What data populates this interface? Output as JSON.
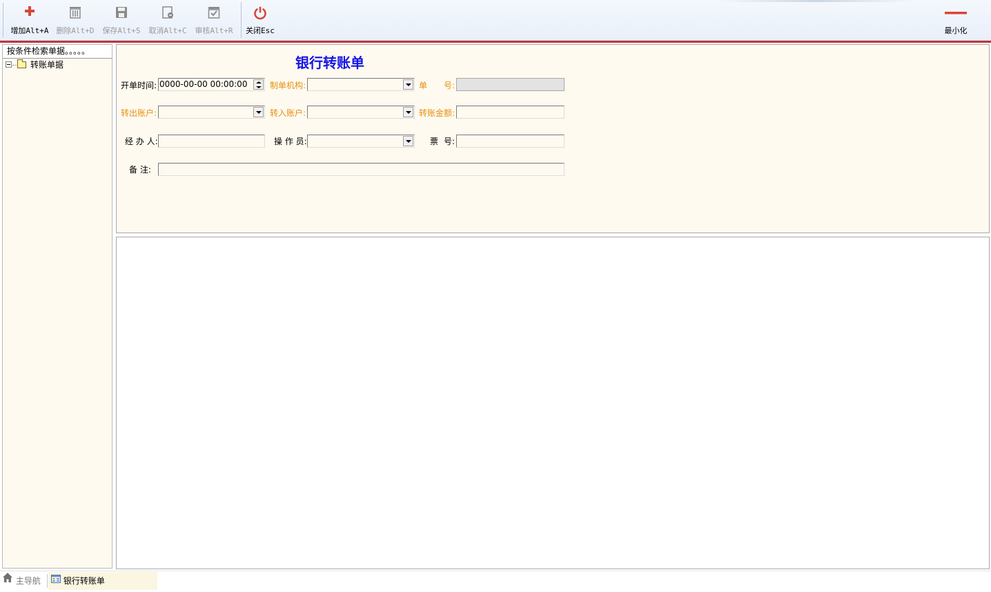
{
  "toolbar": {
    "buttons": [
      {
        "label": "增加Alt+A",
        "icon": "plus-icon",
        "enabled": true
      },
      {
        "label": "删除Alt+D",
        "icon": "trash-icon",
        "enabled": false
      },
      {
        "label": "保存Alt+S",
        "icon": "save-icon",
        "enabled": false
      },
      {
        "label": "取消Alt+C",
        "icon": "cancel-doc-icon",
        "enabled": false
      },
      {
        "label": "审核Alt+R",
        "icon": "approve-icon",
        "enabled": false
      },
      {
        "label": "关闭Esc",
        "icon": "power-icon",
        "enabled": true
      }
    ],
    "minimize_label": "最小化",
    "accent_color": "#c2353b"
  },
  "left_panel": {
    "header": "按条件检索单据。。。。。",
    "tree": [
      {
        "label": "转账单据",
        "icon": "folder-icon",
        "expanded": true
      }
    ]
  },
  "form": {
    "title": "银行转账单",
    "title_color": "#1515e6",
    "required_label_color": "#e69010",
    "fields": {
      "open_time": {
        "label": "开单时间:",
        "value": "0000-00-00 00:00:00"
      },
      "org": {
        "label": "制单机构:",
        "value": ""
      },
      "doc_no": {
        "label_a": "单",
        "label_b": "号:",
        "value": ""
      },
      "out_account": {
        "label": "转出账户:",
        "value": ""
      },
      "in_account": {
        "label": "转入账户:",
        "value": ""
      },
      "amount": {
        "label": "转账金额:",
        "value": ""
      },
      "handler": {
        "label": "经 办 人:",
        "value": ""
      },
      "operator": {
        "label": "操 作 员:",
        "value": ""
      },
      "ticket_no": {
        "label_a": "票",
        "label_b": "号:",
        "value": ""
      },
      "remark": {
        "label": "备 注:",
        "value": ""
      }
    }
  },
  "tabs": {
    "home_label": "主导航",
    "active_label": "银行转账单"
  }
}
